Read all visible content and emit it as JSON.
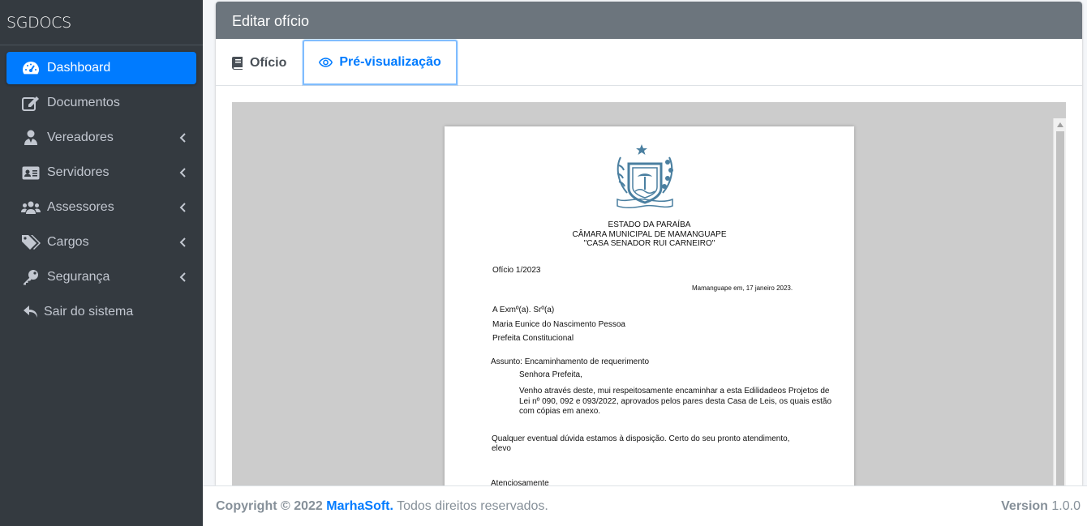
{
  "app": {
    "brand": "SGDOCS"
  },
  "sidebar": {
    "items": [
      {
        "label": "Dashboard",
        "icon": "tachometer-icon",
        "active": true,
        "submenu": false
      },
      {
        "label": "Documentos",
        "icon": "edit-icon",
        "active": false,
        "submenu": false
      },
      {
        "label": "Vereadores",
        "icon": "user-icon",
        "active": false,
        "submenu": true
      },
      {
        "label": "Servidores",
        "icon": "id-card-icon",
        "active": false,
        "submenu": true
      },
      {
        "label": "Assessores",
        "icon": "users-icon",
        "active": false,
        "submenu": true
      },
      {
        "label": "Cargos",
        "icon": "tags-icon",
        "active": false,
        "submenu": true
      },
      {
        "label": "Segurança",
        "icon": "key-icon",
        "active": false,
        "submenu": true
      },
      {
        "label": "Sair do sistema",
        "icon": "reply-icon",
        "active": false,
        "submenu": false
      }
    ]
  },
  "card": {
    "title": "Editar ofício",
    "tabs": [
      {
        "label": "Ofício",
        "icon": "book-icon",
        "active": false
      },
      {
        "label": "Pré-visualização",
        "icon": "eye-icon",
        "active": true
      }
    ]
  },
  "document": {
    "heading": [
      "ESTADO DA PARAÍBA",
      "CÂMARA MUNICIPAL DE MAMANGUAPE",
      "\"CASA SENADOR RUI CARNEIRO\""
    ],
    "number": "Ofício 1/2023",
    "date": "Mamanguape em, 17 janeiro 2023.",
    "recipient": [
      "A Exmº(a). Srº(a)",
      "Maria Eunice do Nascimento Pessoa",
      "Prefeita Constitucional"
    ],
    "subject": "Assunto:  Encaminhamento de requerimento",
    "salutation": "Senhora Prefeita,",
    "body": [
      "Venho através deste, mui respeitosamente encaminhar a esta Edilidadeos Projetos de",
      "Lei nº 090, 092 e 093/2022, aprovados pelos pares desta Casa de Leis, os quais estão",
      "com cópias em anexo."
    ],
    "closing": [
      "Qualquer eventual dúvida estamos à disposição. Certo do seu pronto atendimento,",
      "elevo"
    ],
    "signoff": "Atenciosamente"
  },
  "footer": {
    "copyright": "Copyright © 2022",
    "company": "MarhaSoft.",
    "rights": "Todos direitos reservados.",
    "version_label": "Version",
    "version": "1.0.0"
  },
  "colors": {
    "sidebar_bg": "#343a40",
    "active": "#007bff",
    "header_bg": "#6c757d",
    "crest": "#4a7fa0"
  }
}
